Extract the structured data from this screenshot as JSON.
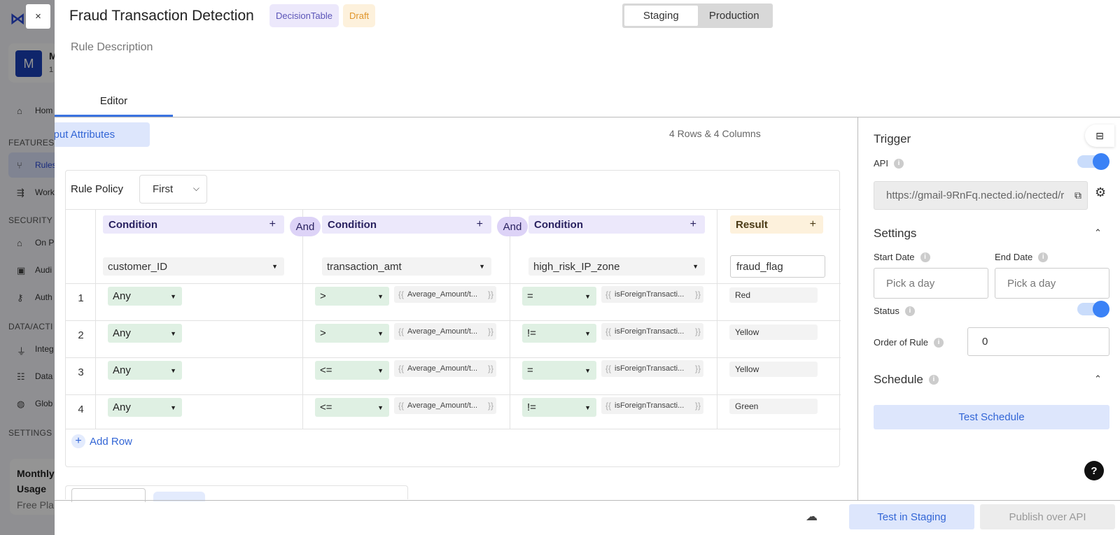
{
  "background": {
    "avatar_letter": "M",
    "user_name": "M",
    "user_sub": "1",
    "nav": [
      {
        "label": "Hom",
        "icon": "home-icon"
      },
      {
        "label": "Rules",
        "icon": "rules-icon"
      },
      {
        "label": "Work",
        "icon": "workflow-icon"
      },
      {
        "label": "On P",
        "icon": "on-premise-icon"
      },
      {
        "label": "Audi",
        "icon": "audit-icon"
      },
      {
        "label": "Auth",
        "icon": "key-icon"
      },
      {
        "label": "Integ",
        "icon": "plug-icon"
      },
      {
        "label": "Data",
        "icon": "database-icon"
      },
      {
        "label": "Glob",
        "icon": "globe-icon"
      }
    ],
    "sections": [
      "FEATURES",
      "SECURITY",
      "DATA/ACTI",
      "SETTINGS"
    ],
    "usage_title": "Monthly Usage",
    "usage_plan": "Free Pla"
  },
  "header": {
    "close_label": "×",
    "title": "Fraud Transaction Detection",
    "badge_type": "DecisionTable",
    "badge_status": "Draft",
    "env_staging": "Staging",
    "env_production": "Production",
    "rule_description": "Rule Description",
    "tab_editor": "Editor"
  },
  "editor": {
    "input_attributes": "Input Attributes",
    "rows_cols": "4 Rows & 4 Columns",
    "rule_policy_label": "Rule Policy",
    "rule_policy_value": "First",
    "and_label": "And",
    "conditions": [
      {
        "header": "Condition",
        "field": "customer_ID"
      },
      {
        "header": "Condition",
        "field": "transaction_amt"
      },
      {
        "header": "Condition",
        "field": "high_risk_IP_zone"
      }
    ],
    "result": {
      "header": "Result",
      "field": "fraud_flag"
    },
    "plus": "+",
    "rows": [
      {
        "num": "1",
        "c1": "Any",
        "c2_op": ">",
        "c2_val": "Average_Amount/t...",
        "c3_op": "=",
        "c3_val": "isForeignTransacti...",
        "result": "Red"
      },
      {
        "num": "2",
        "c1": "Any",
        "c2_op": ">",
        "c2_val": "Average_Amount/t...",
        "c3_op": "!=",
        "c3_val": "isForeignTransacti...",
        "result": "Yellow"
      },
      {
        "num": "3",
        "c1": "Any",
        "c2_op": "<=",
        "c2_val": "Average_Amount/t...",
        "c3_op": "=",
        "c3_val": "isForeignTransacti...",
        "result": "Yellow"
      },
      {
        "num": "4",
        "c1": "Any",
        "c2_op": "<=",
        "c2_val": "Average_Amount/t...",
        "c3_op": "!=",
        "c3_val": "isForeignTransacti...",
        "result": "Green"
      }
    ],
    "add_row": "Add Row"
  },
  "panel": {
    "trigger": "Trigger",
    "api_label": "API",
    "api_enabled": true,
    "api_url": "https://gmail-9RnFq.nected.io/nected/r",
    "settings": "Settings",
    "start_date_label": "Start Date",
    "end_date_label": "End Date",
    "date_placeholder": "Pick a day",
    "status_label": "Status",
    "status_enabled": true,
    "order_label": "Order of Rule",
    "order_value": "0",
    "schedule": "Schedule",
    "test_schedule": "Test Schedule",
    "help": "?"
  },
  "footer": {
    "test_staging": "Test in Staging",
    "publish": "Publish over API"
  },
  "colors": {
    "accent": "#3b82f6",
    "condition_bg": "#ece8fb",
    "result_bg": "#fdf1dc",
    "operator_bg": "#dff0e3"
  }
}
